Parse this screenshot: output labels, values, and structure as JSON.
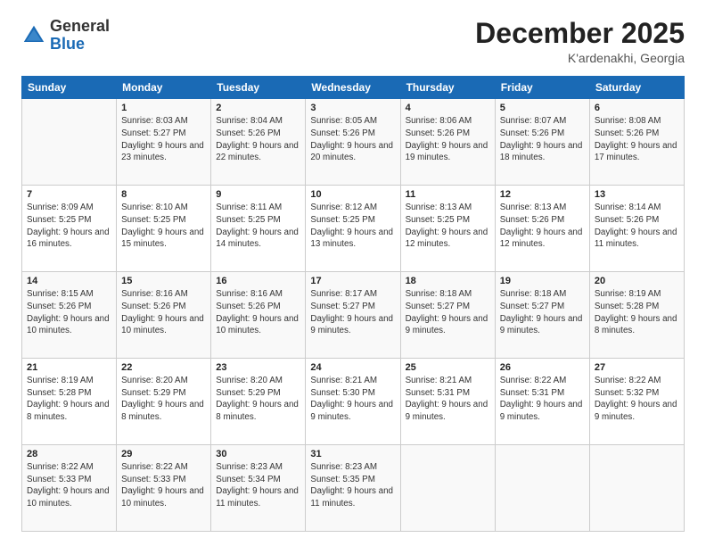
{
  "header": {
    "logo_general": "General",
    "logo_blue": "Blue",
    "month_title": "December 2025",
    "location": "K'ardenakhi, Georgia"
  },
  "weekdays": [
    "Sunday",
    "Monday",
    "Tuesday",
    "Wednesday",
    "Thursday",
    "Friday",
    "Saturday"
  ],
  "weeks": [
    [
      {
        "day": "",
        "sunrise": "",
        "sunset": "",
        "daylight": ""
      },
      {
        "day": "1",
        "sunrise": "Sunrise: 8:03 AM",
        "sunset": "Sunset: 5:27 PM",
        "daylight": "Daylight: 9 hours and 23 minutes."
      },
      {
        "day": "2",
        "sunrise": "Sunrise: 8:04 AM",
        "sunset": "Sunset: 5:26 PM",
        "daylight": "Daylight: 9 hours and 22 minutes."
      },
      {
        "day": "3",
        "sunrise": "Sunrise: 8:05 AM",
        "sunset": "Sunset: 5:26 PM",
        "daylight": "Daylight: 9 hours and 20 minutes."
      },
      {
        "day": "4",
        "sunrise": "Sunrise: 8:06 AM",
        "sunset": "Sunset: 5:26 PM",
        "daylight": "Daylight: 9 hours and 19 minutes."
      },
      {
        "day": "5",
        "sunrise": "Sunrise: 8:07 AM",
        "sunset": "Sunset: 5:26 PM",
        "daylight": "Daylight: 9 hours and 18 minutes."
      },
      {
        "day": "6",
        "sunrise": "Sunrise: 8:08 AM",
        "sunset": "Sunset: 5:26 PM",
        "daylight": "Daylight: 9 hours and 17 minutes."
      }
    ],
    [
      {
        "day": "7",
        "sunrise": "Sunrise: 8:09 AM",
        "sunset": "Sunset: 5:25 PM",
        "daylight": "Daylight: 9 hours and 16 minutes."
      },
      {
        "day": "8",
        "sunrise": "Sunrise: 8:10 AM",
        "sunset": "Sunset: 5:25 PM",
        "daylight": "Daylight: 9 hours and 15 minutes."
      },
      {
        "day": "9",
        "sunrise": "Sunrise: 8:11 AM",
        "sunset": "Sunset: 5:25 PM",
        "daylight": "Daylight: 9 hours and 14 minutes."
      },
      {
        "day": "10",
        "sunrise": "Sunrise: 8:12 AM",
        "sunset": "Sunset: 5:25 PM",
        "daylight": "Daylight: 9 hours and 13 minutes."
      },
      {
        "day": "11",
        "sunrise": "Sunrise: 8:13 AM",
        "sunset": "Sunset: 5:25 PM",
        "daylight": "Daylight: 9 hours and 12 minutes."
      },
      {
        "day": "12",
        "sunrise": "Sunrise: 8:13 AM",
        "sunset": "Sunset: 5:26 PM",
        "daylight": "Daylight: 9 hours and 12 minutes."
      },
      {
        "day": "13",
        "sunrise": "Sunrise: 8:14 AM",
        "sunset": "Sunset: 5:26 PM",
        "daylight": "Daylight: 9 hours and 11 minutes."
      }
    ],
    [
      {
        "day": "14",
        "sunrise": "Sunrise: 8:15 AM",
        "sunset": "Sunset: 5:26 PM",
        "daylight": "Daylight: 9 hours and 10 minutes."
      },
      {
        "day": "15",
        "sunrise": "Sunrise: 8:16 AM",
        "sunset": "Sunset: 5:26 PM",
        "daylight": "Daylight: 9 hours and 10 minutes."
      },
      {
        "day": "16",
        "sunrise": "Sunrise: 8:16 AM",
        "sunset": "Sunset: 5:26 PM",
        "daylight": "Daylight: 9 hours and 10 minutes."
      },
      {
        "day": "17",
        "sunrise": "Sunrise: 8:17 AM",
        "sunset": "Sunset: 5:27 PM",
        "daylight": "Daylight: 9 hours and 9 minutes."
      },
      {
        "day": "18",
        "sunrise": "Sunrise: 8:18 AM",
        "sunset": "Sunset: 5:27 PM",
        "daylight": "Daylight: 9 hours and 9 minutes."
      },
      {
        "day": "19",
        "sunrise": "Sunrise: 8:18 AM",
        "sunset": "Sunset: 5:27 PM",
        "daylight": "Daylight: 9 hours and 9 minutes."
      },
      {
        "day": "20",
        "sunrise": "Sunrise: 8:19 AM",
        "sunset": "Sunset: 5:28 PM",
        "daylight": "Daylight: 9 hours and 8 minutes."
      }
    ],
    [
      {
        "day": "21",
        "sunrise": "Sunrise: 8:19 AM",
        "sunset": "Sunset: 5:28 PM",
        "daylight": "Daylight: 9 hours and 8 minutes."
      },
      {
        "day": "22",
        "sunrise": "Sunrise: 8:20 AM",
        "sunset": "Sunset: 5:29 PM",
        "daylight": "Daylight: 9 hours and 8 minutes."
      },
      {
        "day": "23",
        "sunrise": "Sunrise: 8:20 AM",
        "sunset": "Sunset: 5:29 PM",
        "daylight": "Daylight: 9 hours and 8 minutes."
      },
      {
        "day": "24",
        "sunrise": "Sunrise: 8:21 AM",
        "sunset": "Sunset: 5:30 PM",
        "daylight": "Daylight: 9 hours and 9 minutes."
      },
      {
        "day": "25",
        "sunrise": "Sunrise: 8:21 AM",
        "sunset": "Sunset: 5:31 PM",
        "daylight": "Daylight: 9 hours and 9 minutes."
      },
      {
        "day": "26",
        "sunrise": "Sunrise: 8:22 AM",
        "sunset": "Sunset: 5:31 PM",
        "daylight": "Daylight: 9 hours and 9 minutes."
      },
      {
        "day": "27",
        "sunrise": "Sunrise: 8:22 AM",
        "sunset": "Sunset: 5:32 PM",
        "daylight": "Daylight: 9 hours and 9 minutes."
      }
    ],
    [
      {
        "day": "28",
        "sunrise": "Sunrise: 8:22 AM",
        "sunset": "Sunset: 5:33 PM",
        "daylight": "Daylight: 9 hours and 10 minutes."
      },
      {
        "day": "29",
        "sunrise": "Sunrise: 8:22 AM",
        "sunset": "Sunset: 5:33 PM",
        "daylight": "Daylight: 9 hours and 10 minutes."
      },
      {
        "day": "30",
        "sunrise": "Sunrise: 8:23 AM",
        "sunset": "Sunset: 5:34 PM",
        "daylight": "Daylight: 9 hours and 11 minutes."
      },
      {
        "day": "31",
        "sunrise": "Sunrise: 8:23 AM",
        "sunset": "Sunset: 5:35 PM",
        "daylight": "Daylight: 9 hours and 11 minutes."
      },
      {
        "day": "",
        "sunrise": "",
        "sunset": "",
        "daylight": ""
      },
      {
        "day": "",
        "sunrise": "",
        "sunset": "",
        "daylight": ""
      },
      {
        "day": "",
        "sunrise": "",
        "sunset": "",
        "daylight": ""
      }
    ]
  ]
}
